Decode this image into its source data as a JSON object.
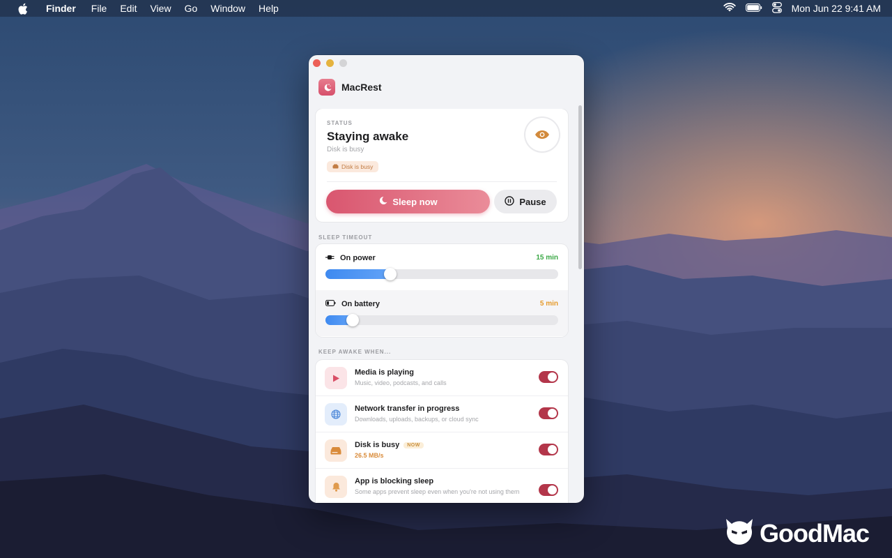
{
  "menubar": {
    "app_name": "Finder",
    "menus": [
      "File",
      "Edit",
      "View",
      "Go",
      "Window",
      "Help"
    ],
    "clock": "Mon Jun 22  9:41 AM"
  },
  "window": {
    "app_title": "MacRest"
  },
  "status": {
    "caption": "STATUS",
    "title": "Staying awake",
    "subtitle": "Disk is busy",
    "chip": "Disk is busy",
    "sleep_button": "Sleep now",
    "pause_button": "Pause"
  },
  "sleep_timeout": {
    "caption": "SLEEP TIMEOUT",
    "rows": [
      {
        "label": "On power",
        "value": "15 min",
        "value_color": "#3aa845",
        "level": 0.25
      },
      {
        "label": "On battery",
        "value": "5 min",
        "value_color": "#e59a2a",
        "level": 0.09
      }
    ]
  },
  "keep_awake": {
    "caption": "KEEP AWAKE WHEN...",
    "items": [
      {
        "title": "Media is playing",
        "subtitle": "Music, video, podcasts, and calls",
        "icon": "play-icon",
        "enabled": true
      },
      {
        "title": "Network transfer in progress",
        "subtitle": "Downloads, uploads, backups, or cloud sync",
        "icon": "globe-icon",
        "enabled": true
      },
      {
        "title": "Disk is busy",
        "badge": "NOW",
        "subtitle": "26.5 MB/s",
        "icon": "disk-icon",
        "enabled": true
      },
      {
        "title": "App is blocking sleep",
        "subtitle": "Some apps prevent sleep even when you're not using them",
        "icon": "bell-icon",
        "enabled": true
      }
    ]
  },
  "brand": {
    "name": "GoodMac"
  },
  "colors": {
    "accent": "#d9566f",
    "toggle_on": "#b3364a",
    "slider_fill": "#3f8af0"
  }
}
